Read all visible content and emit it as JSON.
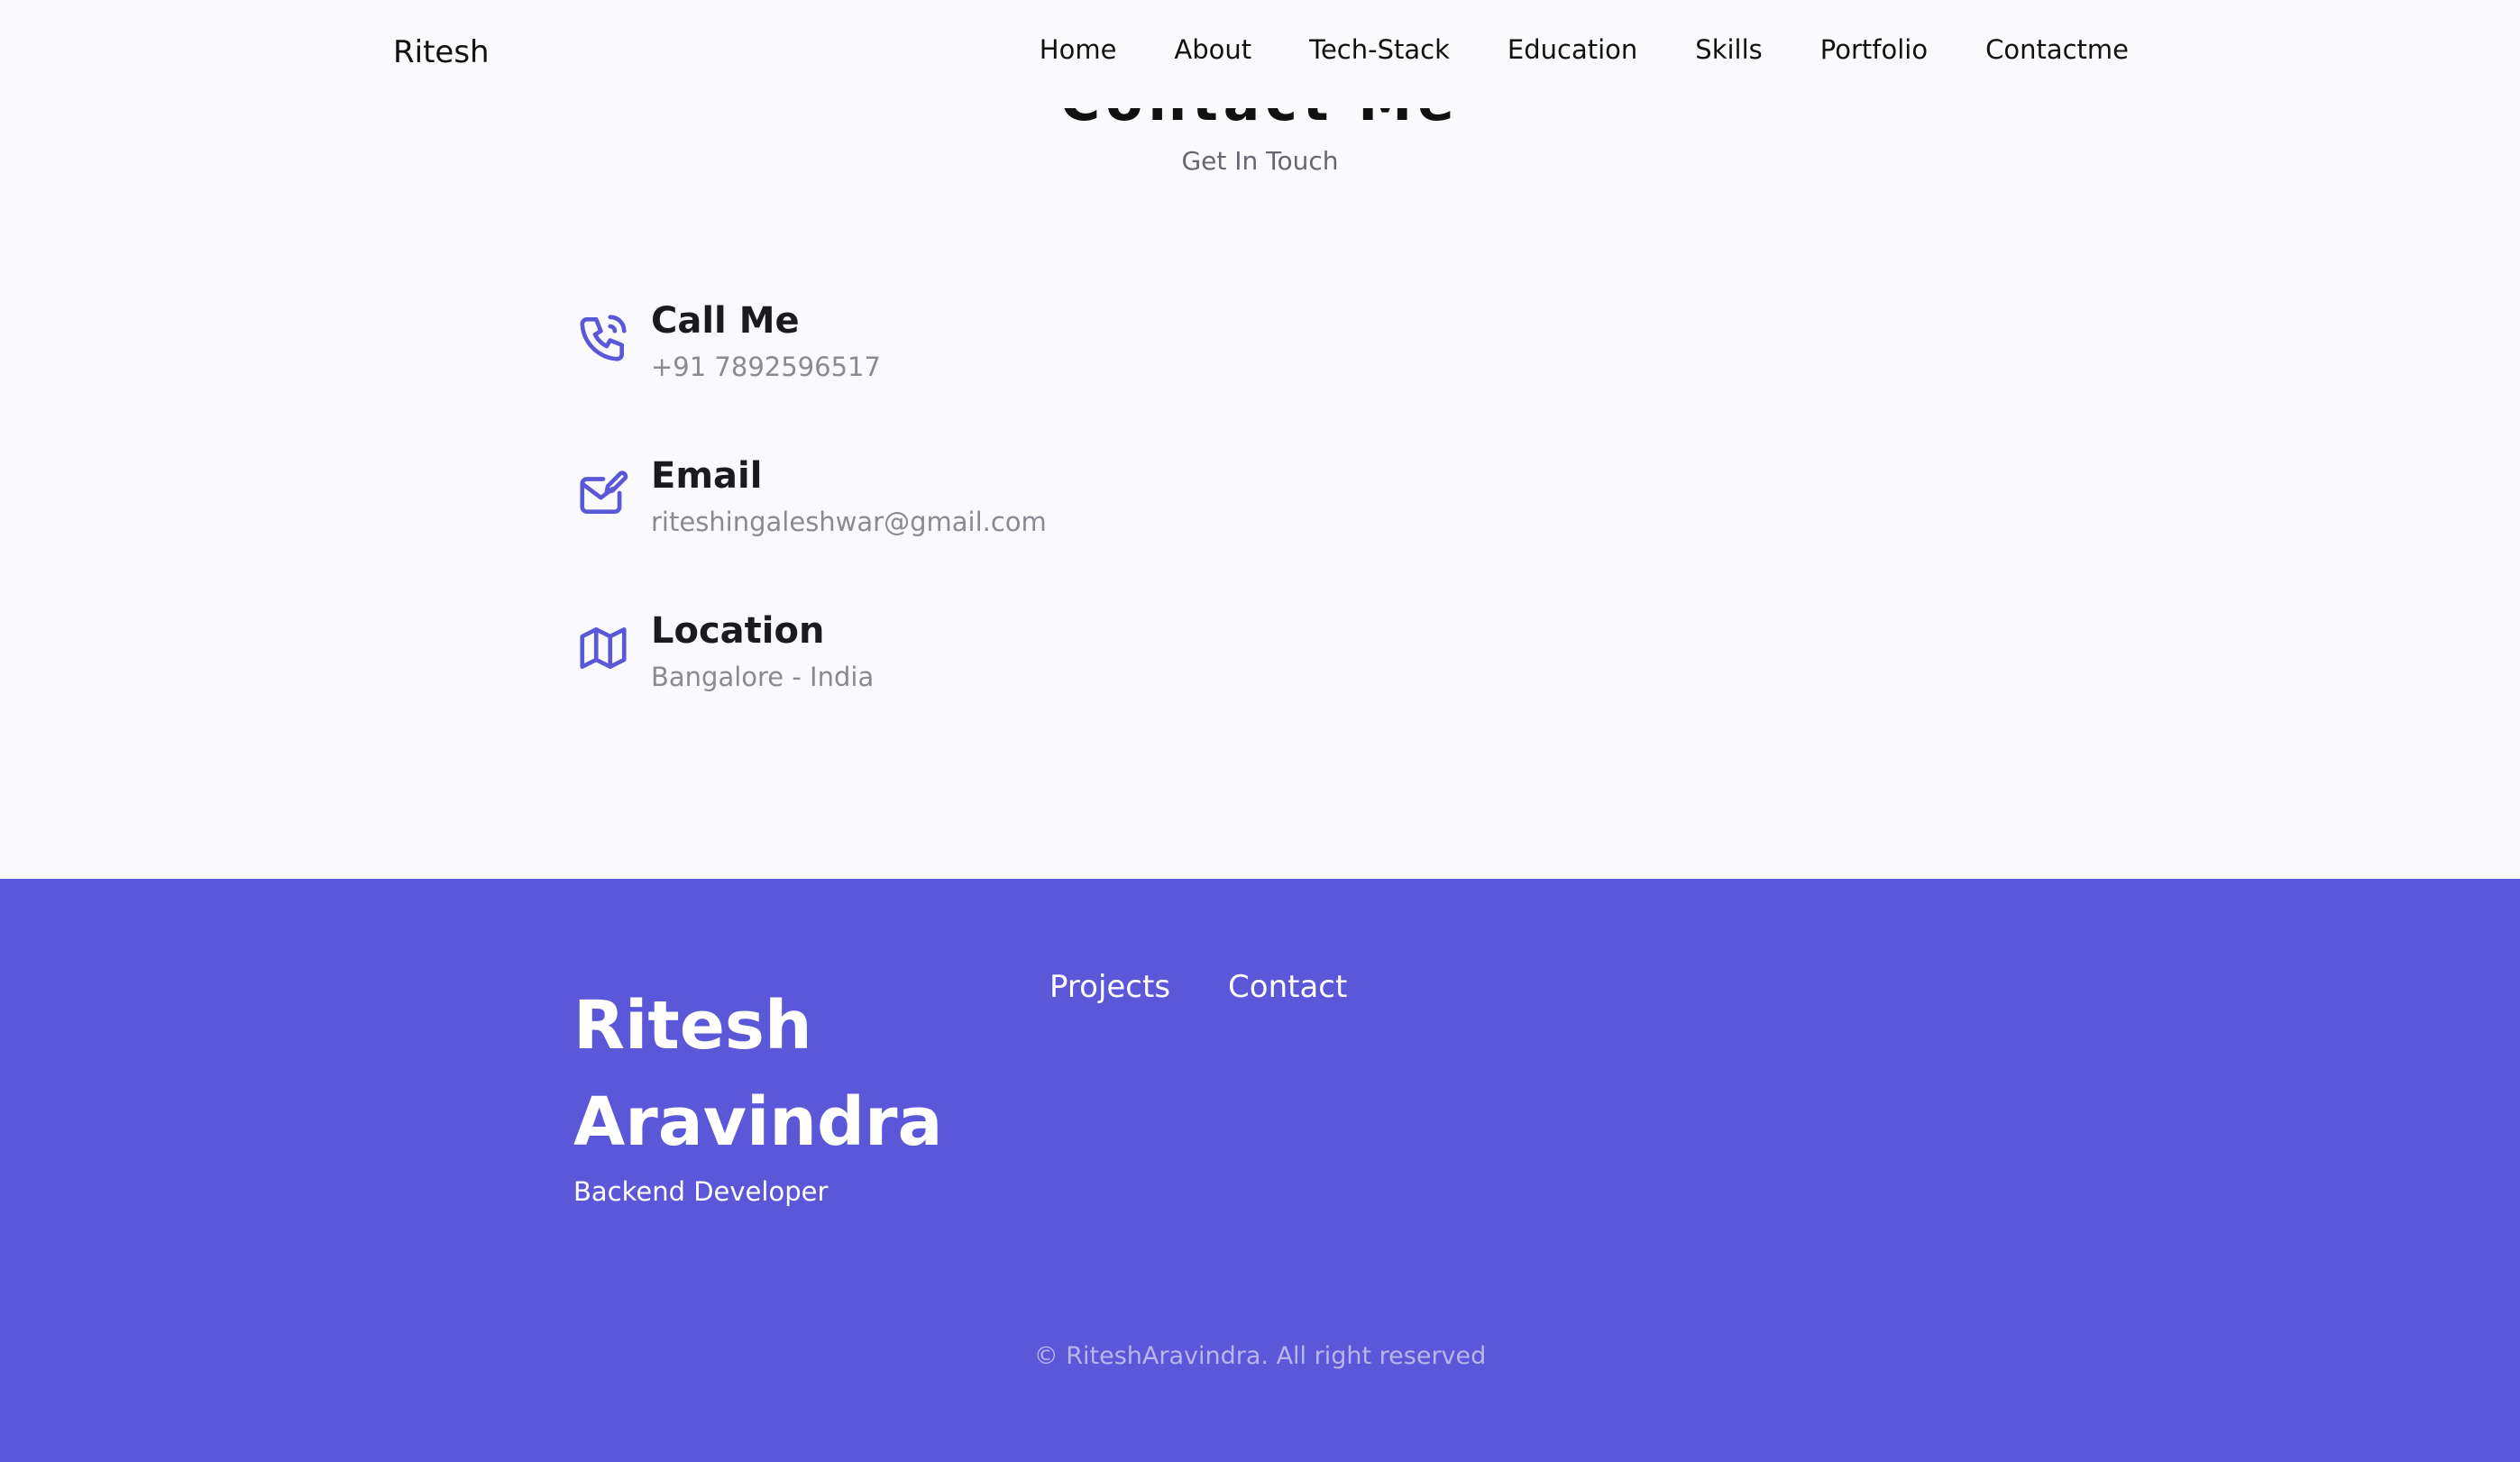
{
  "header": {
    "logo": "Ritesh",
    "nav": [
      "Home",
      "About",
      "Tech-Stack",
      "Education",
      "Skills",
      "Portfolio",
      "Contactme"
    ]
  },
  "section": {
    "title": "Contact Me",
    "subtitle": "Get In Touch"
  },
  "contact": [
    {
      "title": "Call Me",
      "value": "+91 7892596517",
      "icon": "phone-icon"
    },
    {
      "title": "Email",
      "value": "riteshingaleshwar@gmail.com",
      "icon": "mail-edit-icon"
    },
    {
      "title": "Location",
      "value": "Bangalore - India",
      "icon": "map-icon"
    }
  ],
  "footer": {
    "name": "Ritesh Aravindra",
    "role": "Backend Developer",
    "links": [
      "Projects",
      "Contact"
    ],
    "copyright": "© RiteshAravindra. All right reserved"
  },
  "colors": {
    "accent": "#5a58d8",
    "background": "#fafafc",
    "icon": "#5a58d8"
  }
}
